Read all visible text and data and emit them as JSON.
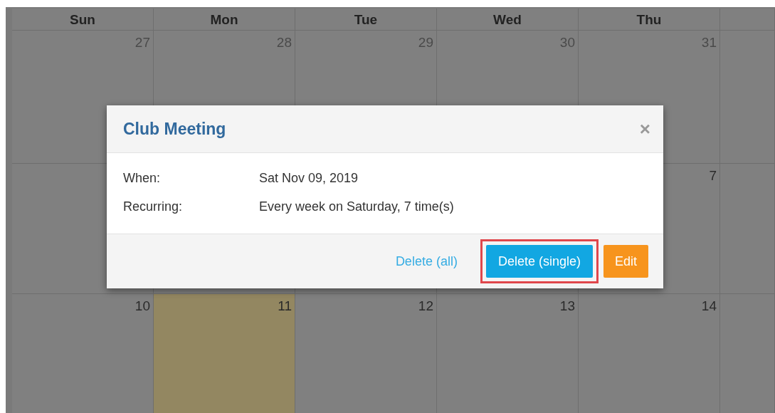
{
  "calendar": {
    "columns": [
      "Sun",
      "Mon",
      "Tue",
      "Wed",
      "Thu"
    ],
    "weeks": [
      {
        "cells": [
          {
            "day": "27",
            "muted": true,
            "today": false
          },
          {
            "day": "28",
            "muted": true,
            "today": false
          },
          {
            "day": "29",
            "muted": true,
            "today": false
          },
          {
            "day": "30",
            "muted": true,
            "today": false
          },
          {
            "day": "31",
            "muted": true,
            "today": false
          },
          {
            "today": false
          }
        ]
      },
      {
        "cells": [
          {
            "today": false
          },
          {
            "today": false
          },
          {
            "today": false
          },
          {
            "today": false
          },
          {
            "day": "7",
            "muted": false,
            "today": false
          },
          {
            "today": false
          }
        ]
      },
      {
        "cells": [
          {
            "day": "10",
            "muted": false,
            "today": false
          },
          {
            "day": "11",
            "muted": false,
            "today": true
          },
          {
            "day": "12",
            "muted": false,
            "today": false
          },
          {
            "day": "13",
            "muted": false,
            "today": false
          },
          {
            "day": "14",
            "muted": false,
            "today": false
          },
          {
            "today": false
          }
        ]
      }
    ]
  },
  "dialog": {
    "title": "Club Meeting",
    "close": "×",
    "fields": [
      {
        "label": "When:",
        "value": "Sat Nov 09, 2019"
      },
      {
        "label": "Recurring:",
        "value": "Every week on Saturday, 7 time(s)"
      }
    ],
    "buttons": [
      {
        "label": "Delete (all)",
        "kind": "link",
        "highlighted": false
      },
      {
        "label": "Delete (single)",
        "kind": "primary",
        "highlighted": true
      },
      {
        "label": "Edit",
        "kind": "warning",
        "highlighted": false
      }
    ]
  }
}
